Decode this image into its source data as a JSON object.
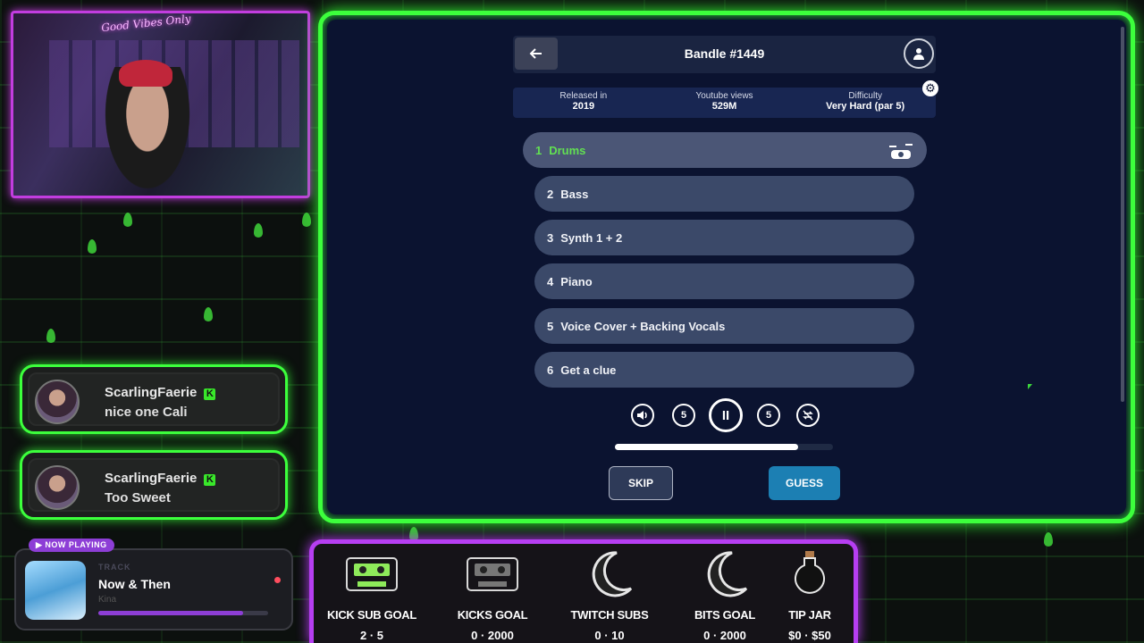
{
  "webcam": {
    "signature": "Good Vibes Only"
  },
  "chat": [
    {
      "user": "ScarlingFaerie",
      "badge": "K",
      "message": "nice one Cali"
    },
    {
      "user": "ScarlingFaerie",
      "badge": "K",
      "message": "Too Sweet"
    }
  ],
  "now_playing": {
    "tag": "▶ NOW PLAYING",
    "label": "TRACK",
    "title": "Now & Then",
    "artist": "Kina",
    "progress": 0.85
  },
  "game": {
    "title": "Bandle #1449",
    "info": [
      {
        "label": "Released in",
        "value": "2019"
      },
      {
        "label": "Youtube views",
        "value": "529M"
      },
      {
        "label": "Difficulty",
        "value": "Very Hard (par 5)"
      }
    ],
    "rows": [
      {
        "num": "1",
        "label": "Drums",
        "active": true
      },
      {
        "num": "2",
        "label": "Bass"
      },
      {
        "num": "3",
        "label": "Synth 1 + 2"
      },
      {
        "num": "4",
        "label": "Piano"
      },
      {
        "num": "5",
        "label": "Voice Cover + Backing Vocals"
      },
      {
        "num": "6",
        "label": "Get a clue"
      }
    ],
    "controls": {
      "volume_icon": "speaker-icon",
      "rewind_label": "5",
      "pause_label": "II",
      "forward_label": "5",
      "loop_icon": "no-loop-icon"
    },
    "progress": 0.84,
    "skip_label": "SKIP",
    "guess_label": "GUESS",
    "accent": "#62e052",
    "guess_color": "#1c7fb3"
  },
  "goals": [
    {
      "label": "KICK SUB GOAL",
      "value": "2 · 5",
      "icon": "cassette-icon"
    },
    {
      "label": "KICKS GOAL",
      "value": "0 · 2000",
      "icon": "cassette-icon"
    },
    {
      "label": "TWITCH SUBS",
      "value": "0 · 10",
      "icon": "moon-icon"
    },
    {
      "label": "BITS GOAL",
      "value": "0 · 2000",
      "icon": "moon-icon"
    },
    {
      "label": "TIP JAR",
      "value": "$0 · $50",
      "icon": "potion-icon"
    }
  ]
}
